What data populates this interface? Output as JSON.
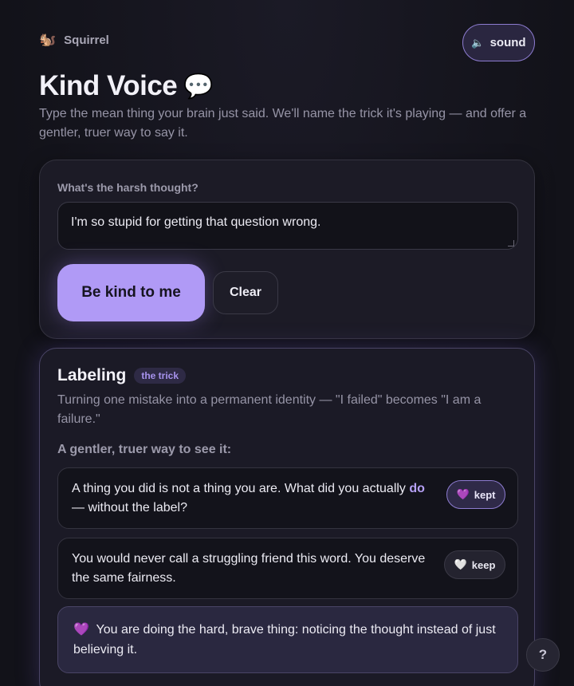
{
  "app": {
    "name": "Squirrel",
    "icon": "🐿️"
  },
  "sound_button": {
    "icon": "🔈",
    "label": "sound"
  },
  "header": {
    "title": "Kind Voice",
    "title_icon": "💬",
    "subtitle": "Type the mean thing your brain just said. We'll name the trick it's playing — and offer a gentler, truer way to say it."
  },
  "input_card": {
    "field_label": "What's the harsh thought?",
    "thought_value": "I'm so stupid for getting that question wrong.",
    "primary_button": "Be kind to me",
    "clear_button": "Clear"
  },
  "result": {
    "distortion_name": "Labeling",
    "badge": "the trick",
    "description": "Turning one mistake into a permanent identity — \"I failed\" becomes \"I am a failure.\"",
    "reframe_label": "A gentler, truer way to see it:",
    "reframes": [
      {
        "text_before": "A thing you did is not a thing you are. What did you actually ",
        "text_emphasis": "do",
        "text_after": " — without the label?",
        "button_icon": "💜",
        "button_label": "kept",
        "state": "kept"
      },
      {
        "text_before": "You would never call a struggling friend this word. You deserve the same fairness.",
        "text_emphasis": "",
        "text_after": "",
        "button_icon": "🤍",
        "button_label": "keep",
        "state": "keep"
      }
    ],
    "affirmation": {
      "icon": "💜",
      "text": "You are doing the hard, brave thing: noticing the thought instead of just believing it."
    }
  },
  "help_button": {
    "label": "?"
  },
  "colors": {
    "background": "#14141c",
    "card": "#1c1b26",
    "accent": "#b09af6",
    "accent_border": "#8d7cd0",
    "muted_text": "#9694a6"
  }
}
